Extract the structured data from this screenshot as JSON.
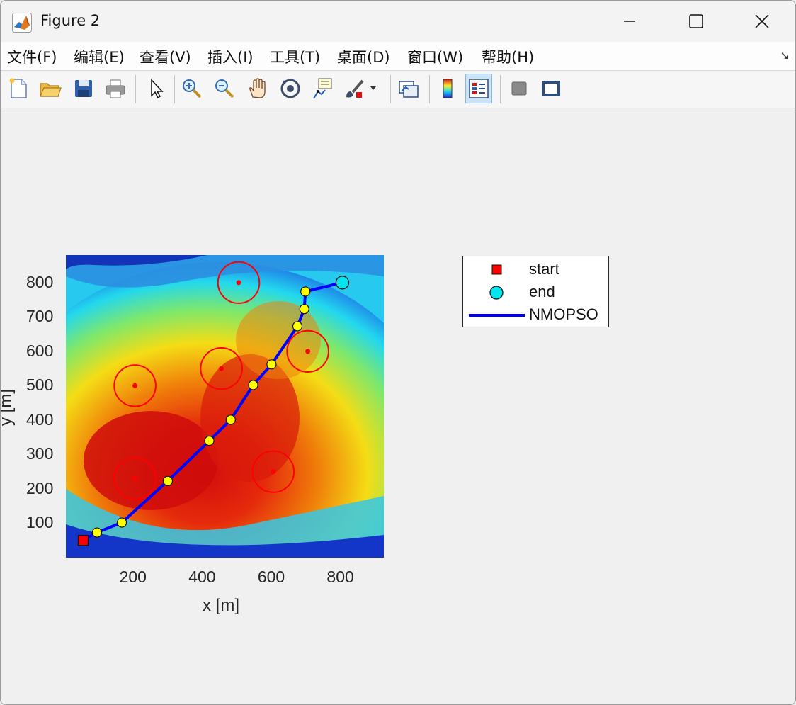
{
  "window": {
    "title": "Figure 2",
    "controls": {
      "minimize": "—",
      "maximize": "□",
      "close": "✕"
    }
  },
  "menu": {
    "items": [
      "文件(F)",
      "编辑(E)",
      "查看(V)",
      "插入(I)",
      "工具(T)",
      "桌面(D)",
      "窗口(W)",
      "帮助(H)"
    ]
  },
  "toolbar": {
    "buttons": [
      "new-figure",
      "open-file",
      "save-figure",
      "print-figure",
      "edit-plot",
      "zoom-in",
      "zoom-out",
      "pan",
      "rotate-3d",
      "data-cursor",
      "brush",
      "link-plot",
      "insert-colorbar",
      "insert-legend",
      "hide-plot-tools",
      "show-plot-tools"
    ],
    "pressed": "insert-legend"
  },
  "chart_data": {
    "type": "scatter",
    "xlabel": "x [m]",
    "ylabel": "y [m]",
    "xlim": [
      0,
      920
    ],
    "ylim": [
      0,
      880
    ],
    "xticks": [
      200,
      400,
      600,
      800
    ],
    "yticks": [
      100,
      200,
      300,
      400,
      500,
      600,
      700,
      800
    ],
    "background": "terrain elevation map (jet colormap, red = high, blue = low)",
    "legend": {
      "position": "outside-right",
      "entries": [
        "start",
        "end",
        "NMOPSO"
      ]
    },
    "start": {
      "x": 50,
      "y": 50,
      "color": "#ff0000"
    },
    "end": {
      "x": 800,
      "y": 800,
      "color": "#00e5ee"
    },
    "path": {
      "name": "NMOPSO",
      "color": "#0000ff",
      "x": [
        50,
        90,
        162,
        295,
        415,
        477,
        542,
        595,
        670,
        690,
        693,
        800
      ],
      "y": [
        50,
        73,
        102,
        223,
        340,
        401,
        502,
        562,
        673,
        723,
        774,
        800
      ],
      "waypoint_color": "#ffff00"
    },
    "obstacles": {
      "color": "#ff0000",
      "centers_x": [
        200,
        500,
        450,
        700,
        200,
        600
      ],
      "centers_y": [
        500,
        800,
        550,
        600,
        230,
        250
      ],
      "radius": 60
    }
  }
}
